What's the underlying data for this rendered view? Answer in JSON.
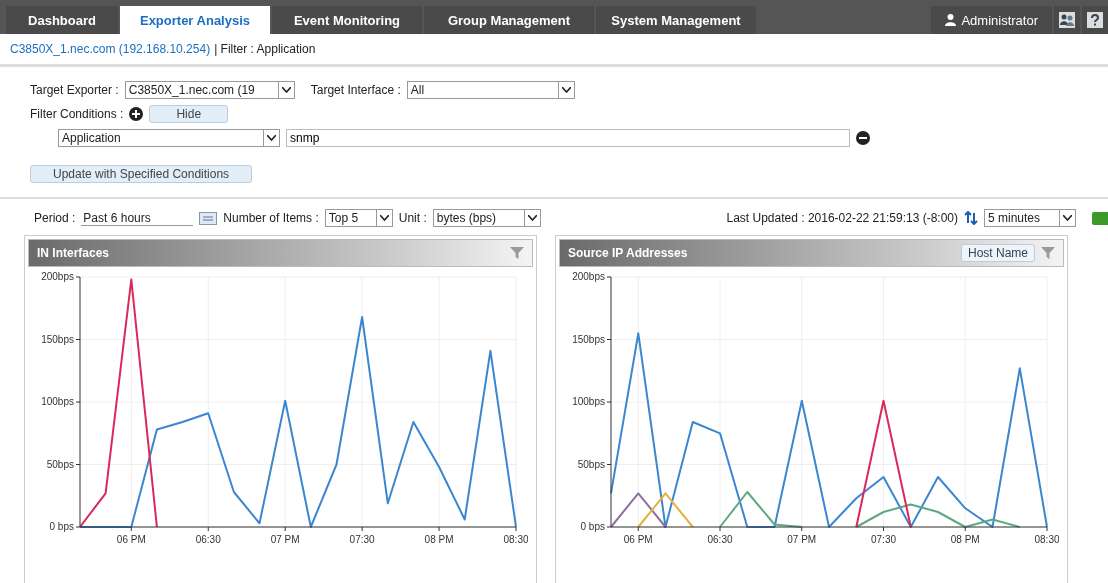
{
  "tabs": [
    {
      "label": "Dashboard",
      "selected": false
    },
    {
      "label": "Exporter Analysis",
      "selected": true
    },
    {
      "label": "Event Monitoring",
      "selected": false
    },
    {
      "label": "Group Management",
      "selected": false
    },
    {
      "label": "System Management",
      "selected": false
    }
  ],
  "user": "Administrator",
  "breadcrumb": {
    "link": "C3850X_1.nec.com (192.168.10.254)",
    "rest": "| Filter : Application"
  },
  "filter_form": {
    "target_exporter_label": "Target Exporter :",
    "target_exporter": "C3850X_1.nec.com (19",
    "target_interface_label": "Target Interface :",
    "target_interface": "All",
    "conditions_label": "Filter Conditions :",
    "hide_button": "Hide",
    "condition_field": "Application",
    "condition_value": "snmp",
    "update_button": "Update with Specified Conditions"
  },
  "toolbar": {
    "period_label": "Period :",
    "period": "Past 6 hours",
    "items_label": "Number of Items :",
    "items": "Top 5",
    "unit_label": "Unit :",
    "unit": "bytes (bps)",
    "last_updated": "Last Updated : 2016-02-22 21:59:13 (-8:00)",
    "refresh": "5 minutes"
  },
  "panels": [
    {
      "title": "IN Interfaces",
      "chart_data": {
        "type": "line",
        "grid": true,
        "categories": [
          null,
          null,
          "06 PM",
          null,
          null,
          "06:30",
          null,
          null,
          "07 PM",
          null,
          null,
          "07:30",
          null,
          null,
          "08 PM",
          null,
          null,
          "08:30"
        ],
        "ylim": [
          0,
          200
        ],
        "yticks": [
          {
            "value": 0,
            "label": "0 bps"
          },
          {
            "value": 50,
            "label": "50bps"
          },
          {
            "value": 100,
            "label": "100bps"
          },
          {
            "value": 150,
            "label": "150bps"
          },
          {
            "value": 200,
            "label": "200bps"
          }
        ],
        "series": [
          {
            "color": "#3a87cf",
            "values": [
              0,
              0,
              0,
              78,
              84,
              91,
              28,
              3,
              101,
              0,
              50,
              168,
              19,
              84,
              48,
              6,
              141,
              0
            ]
          },
          {
            "color": "#d9285a",
            "values": [
              0,
              27,
              198,
              0,
              null,
              null,
              null,
              null,
              null,
              null,
              null,
              null,
              null,
              null,
              null,
              null,
              null,
              null
            ]
          }
        ]
      }
    },
    {
      "title": "Source IP Addresses",
      "button": "Host Name",
      "chart_data": {
        "type": "line",
        "grid": true,
        "categories": [
          null,
          "06 PM",
          null,
          null,
          "06:30",
          null,
          null,
          "07 PM",
          null,
          null,
          "07:30",
          null,
          null,
          "08 PM",
          null,
          null,
          "08:30"
        ],
        "ylim": [
          0,
          200
        ],
        "yticks": [
          {
            "value": 0,
            "label": "0 bps"
          },
          {
            "value": 50,
            "label": "50bps"
          },
          {
            "value": 100,
            "label": "100bps"
          },
          {
            "value": 150,
            "label": "150bps"
          },
          {
            "value": 200,
            "label": "200bps"
          }
        ],
        "series": [
          {
            "color": "#3a87cf",
            "values": [
              27,
              155,
              0,
              84,
              75,
              0,
              0,
              101,
              0,
              23,
              40,
              0,
              40,
              15,
              0,
              127,
              0
            ]
          },
          {
            "color": "#8e6f9e",
            "values": [
              0,
              27,
              0,
              null,
              null,
              null,
              null,
              null,
              null,
              null,
              null,
              null,
              null,
              null,
              null,
              null,
              null
            ]
          },
          {
            "color": "#e8b040",
            "values": [
              null,
              0,
              27,
              0,
              null,
              null,
              null,
              null,
              null,
              null,
              null,
              null,
              null,
              null,
              null,
              null,
              null
            ]
          },
          {
            "color": "#5fa882",
            "values": [
              null,
              null,
              null,
              null,
              0,
              28,
              2,
              0,
              null,
              0,
              12,
              18,
              12,
              0,
              6,
              0,
              null
            ]
          },
          {
            "color": "#d9285a",
            "values": [
              null,
              null,
              null,
              null,
              null,
              null,
              null,
              null,
              null,
              0,
              101,
              0,
              null,
              null,
              null,
              null,
              null
            ]
          }
        ]
      }
    }
  ]
}
